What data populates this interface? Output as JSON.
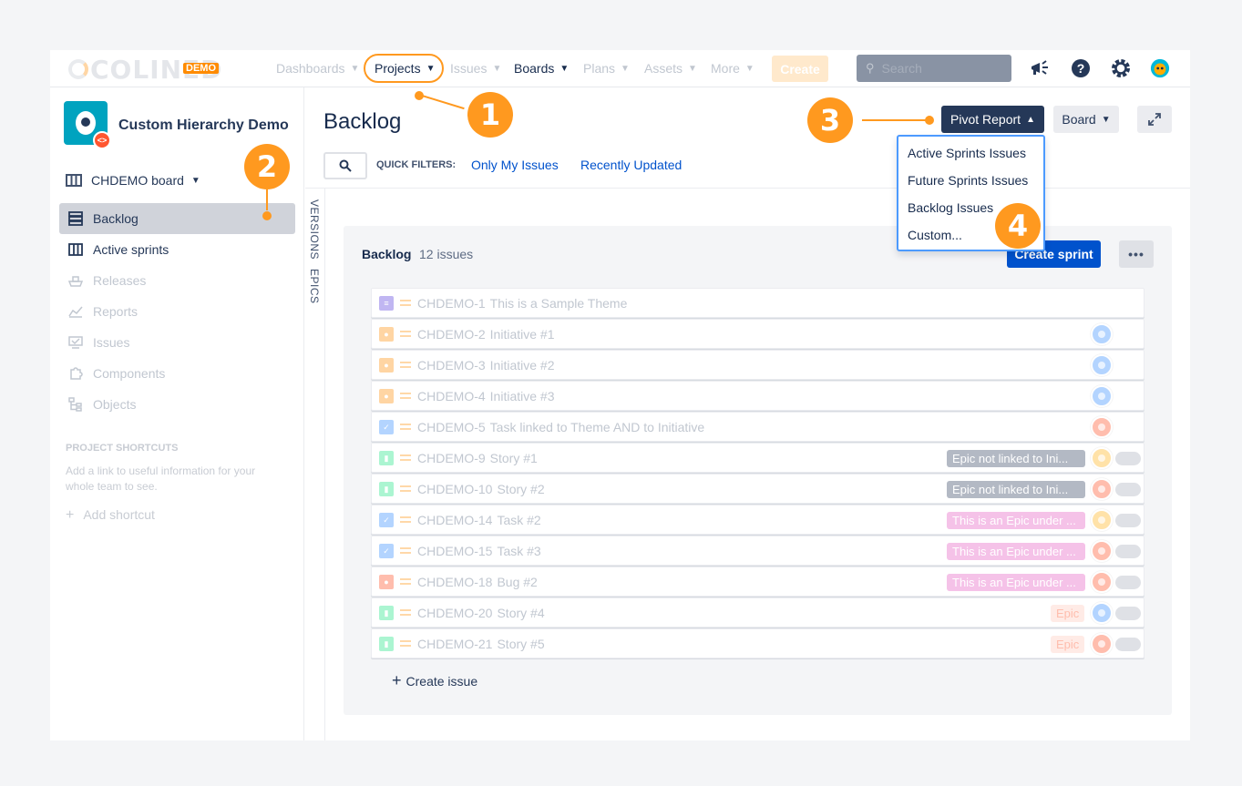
{
  "topnav": {
    "logo_text": "COLINED",
    "logo_badge": "DEMO",
    "items": [
      {
        "label": "Dashboards"
      },
      {
        "label": "Projects"
      },
      {
        "label": "Issues"
      },
      {
        "label": "Boards"
      },
      {
        "label": "Plans"
      },
      {
        "label": "Assets"
      },
      {
        "label": "More"
      }
    ],
    "create_label": "Create",
    "search_placeholder": "Search"
  },
  "sidebar": {
    "project_name": "Custom Hierarchy Demo",
    "board_name": "CHDEMO board",
    "items": [
      {
        "label": "Backlog"
      },
      {
        "label": "Active sprints"
      },
      {
        "label": "Releases"
      },
      {
        "label": "Reports"
      },
      {
        "label": "Issues"
      },
      {
        "label": "Components"
      },
      {
        "label": "Objects"
      }
    ],
    "shortcuts_heading": "PROJECT SHORTCUTS",
    "shortcuts_text": "Add a link to useful information for your whole team to see.",
    "add_shortcut": "Add shortcut"
  },
  "main": {
    "title": "Backlog",
    "pivot_label": "Pivot Report",
    "board_label": "Board",
    "quick_filters_label": "QUICK FILTERS:",
    "quick_filters": [
      "Only My Issues",
      "Recently Updated"
    ],
    "side_tabs": [
      "VERSIONS",
      "EPICS"
    ]
  },
  "dropdown": {
    "items": [
      "Active Sprints Issues",
      "Future Sprints Issues",
      "Backlog Issues",
      "Custom..."
    ]
  },
  "backlog": {
    "title": "Backlog",
    "count": "12 issues",
    "create_sprint": "Create sprint",
    "create_issue": "Create issue",
    "issues": [
      {
        "key": "CHDEMO-1",
        "summary": "This is a Sample Theme",
        "type": "theme",
        "epic": "",
        "avatar": false
      },
      {
        "key": "CHDEMO-2",
        "summary": "Initiative #1",
        "type": "initiative",
        "epic": "",
        "avatar": true
      },
      {
        "key": "CHDEMO-3",
        "summary": "Initiative #2",
        "type": "initiative",
        "epic": "",
        "avatar": true
      },
      {
        "key": "CHDEMO-4",
        "summary": "Initiative #3",
        "type": "initiative",
        "epic": "",
        "avatar": true
      },
      {
        "key": "CHDEMO-5",
        "summary": "Task linked to Theme AND to Initiative",
        "type": "task",
        "epic": "",
        "avatar": true
      },
      {
        "key": "CHDEMO-9",
        "summary": "Story #1",
        "type": "story",
        "epic": "Epic not linked to Ini...",
        "avatar": true
      },
      {
        "key": "CHDEMO-10",
        "summary": "Story #2",
        "type": "story",
        "epic": "Epic not linked to Ini...",
        "avatar": true
      },
      {
        "key": "CHDEMO-14",
        "summary": "Task #2",
        "type": "task",
        "epic": "This is an Epic under ...",
        "avatar": true
      },
      {
        "key": "CHDEMO-15",
        "summary": "Task #3",
        "type": "task",
        "epic": "This is an Epic under ...",
        "avatar": true
      },
      {
        "key": "CHDEMO-18",
        "summary": "Bug #2",
        "type": "bug",
        "epic": "This is an Epic under ...",
        "avatar": true
      },
      {
        "key": "CHDEMO-20",
        "summary": "Story #4",
        "type": "story",
        "epic": "Epic",
        "avatar": true
      },
      {
        "key": "CHDEMO-21",
        "summary": "Story #5",
        "type": "story",
        "epic": "Epic",
        "avatar": true
      }
    ]
  },
  "callouts": [
    "1",
    "2",
    "3",
    "4"
  ],
  "colors": {
    "accent": "#ff991f",
    "primary": "#0052cc",
    "dark": "#253858"
  }
}
